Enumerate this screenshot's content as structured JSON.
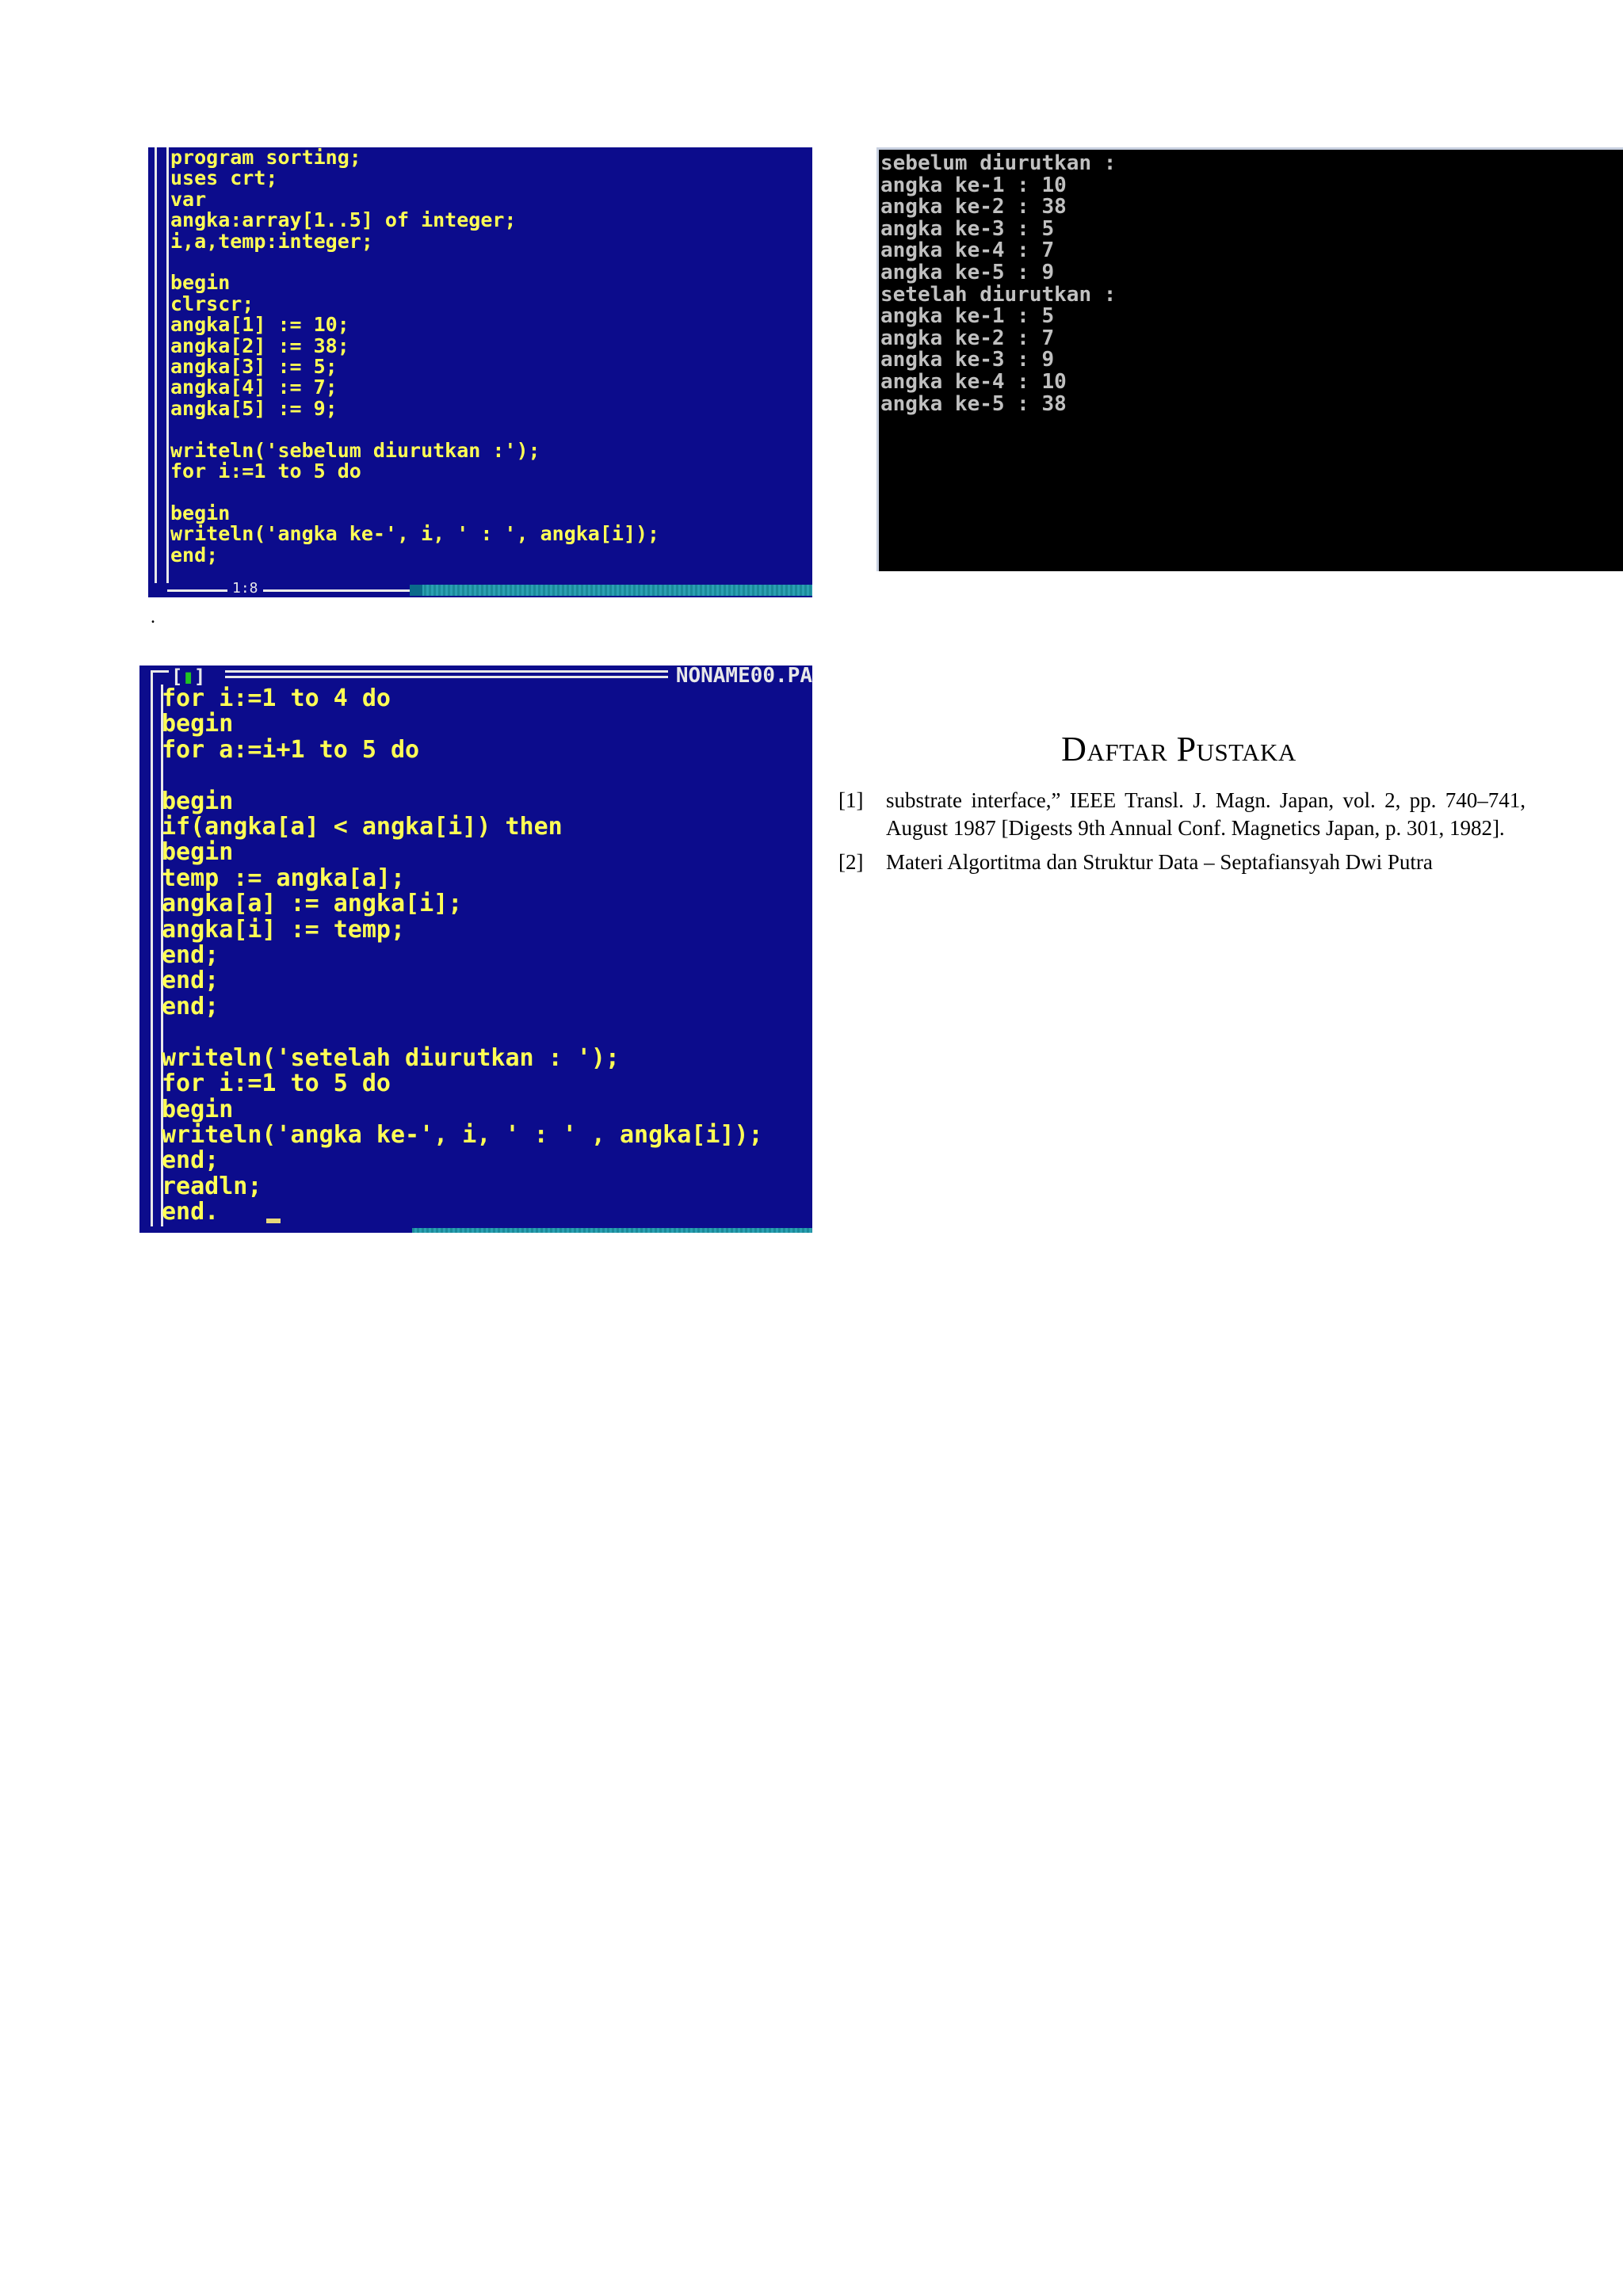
{
  "editor1": {
    "lines": [
      "program sorting;",
      "uses crt;",
      "var",
      "angka:array[1..5] of integer;",
      "i,a,temp:integer;",
      "",
      "begin",
      "clrscr;",
      "angka[1] := 10;",
      "angka[2] := 38;",
      "angka[3] := 5;",
      "angka[4] := 7;",
      "angka[5] := 9;",
      "",
      "writeln('sebelum diurutkan :');",
      "for i:=1 to 5 do",
      "",
      "begin",
      "writeln('angka ke-', i, ' : ', angka[i]);",
      "end;"
    ],
    "status_position": "1:8"
  },
  "output": {
    "lines": [
      "sebelum diurutkan :",
      "angka ke-1 : 10",
      "angka ke-2 : 38",
      "angka ke-3 : 5",
      "angka ke-4 : 7",
      "angka ke-5 : 9",
      "setelah diurutkan :",
      "angka ke-1 : 5",
      "angka ke-2 : 7",
      "angka ke-3 : 9",
      "angka ke-4 : 10",
      "angka ke-5 : 38"
    ]
  },
  "separator_mark": ".",
  "editor2": {
    "close_box": "[",
    "close_glyph": "▮",
    "close_box_end": "]",
    "filename": "NONAME00.PA",
    "lines": [
      "for i:=1 to 4 do",
      "begin",
      "for a:=i+1 to 5 do",
      "",
      "begin",
      "if(angka[a] < angka[i]) then",
      "begin",
      "temp := angka[a];",
      "angka[a] := angka[i];",
      "angka[i] := temp;",
      "end;",
      "end;",
      "end;",
      "",
      "writeln('setelah diurutkan : ');",
      "for i:=1 to 5 do",
      "begin",
      "writeln('angka ke-', i, ' : ' , angka[i]);",
      "end;",
      "readln;",
      "end."
    ]
  },
  "references": {
    "heading": "Daftar Pustaka",
    "items": [
      {
        "num": "[1]",
        "text": "substrate interface,” IEEE Transl. J. Magn. Japan, vol. 2, pp. 740–741, August 1987 [Digests 9th Annual Conf. Magnetics Japan, p. 301, 1982]."
      },
      {
        "num": "[2]",
        "text": "Materi Algortitma dan Struktur Data – Septafiansyah Dwi Putra"
      }
    ]
  }
}
